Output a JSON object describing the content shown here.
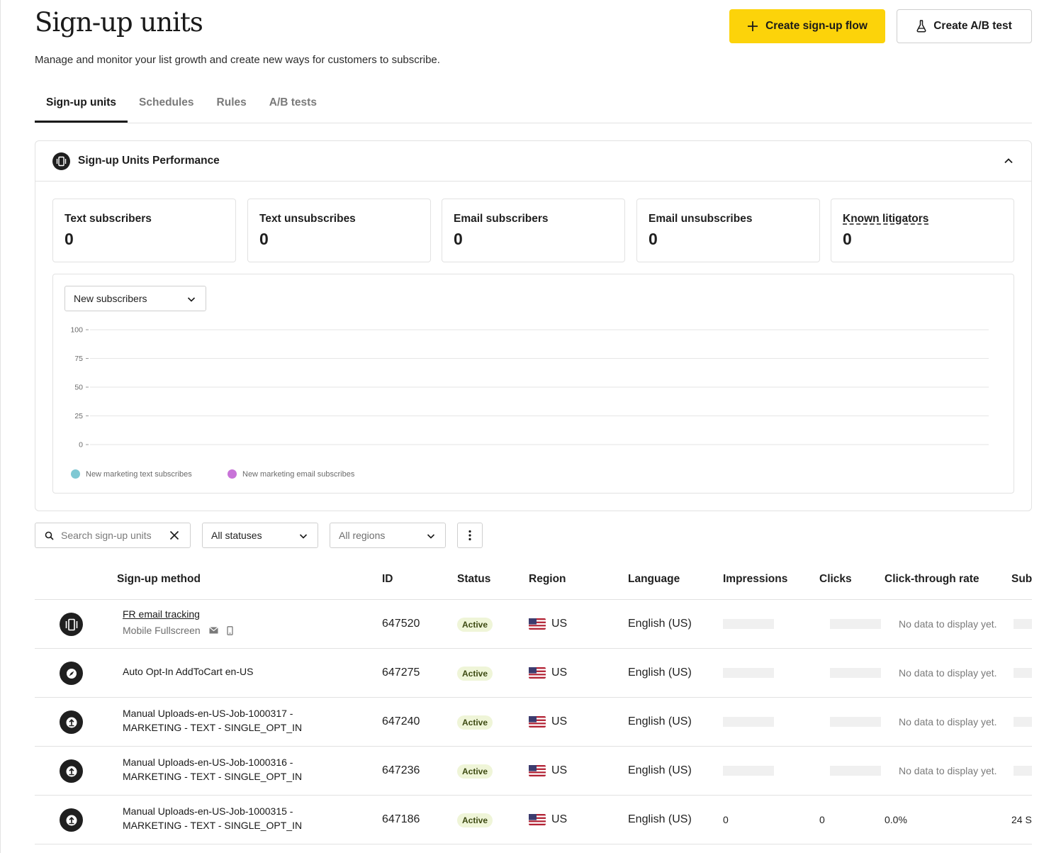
{
  "header": {
    "title": "Sign-up units",
    "subtitle": "Manage and monitor your list growth and create new ways for customers to subscribe.",
    "primary_button": "Create sign-up flow",
    "secondary_button": "Create A/B test"
  },
  "tabs": [
    {
      "label": "Sign-up units",
      "active": true
    },
    {
      "label": "Schedules",
      "active": false
    },
    {
      "label": "Rules",
      "active": false
    },
    {
      "label": "A/B tests",
      "active": false
    }
  ],
  "performance": {
    "title": "Sign-up Units Performance",
    "stats": [
      {
        "label": "Text subscribers",
        "value": "0"
      },
      {
        "label": "Text unsubscribes",
        "value": "0"
      },
      {
        "label": "Email subscribers",
        "value": "0"
      },
      {
        "label": "Email unsubscribes",
        "value": "0"
      },
      {
        "label": "Known litigators",
        "value": "0"
      }
    ],
    "metric_select": "New subscribers"
  },
  "chart_data": {
    "type": "line",
    "title": "",
    "xlabel": "",
    "ylabel": "",
    "ylim": [
      0,
      100
    ],
    "yticks": [
      100,
      75,
      50,
      25,
      0
    ],
    "grid": true,
    "legend_placement": "bottom-left",
    "series": [
      {
        "name": "New marketing text subscribes",
        "color": "#7ec8d3",
        "values": []
      },
      {
        "name": "New marketing email subscribes",
        "color": "#c873d8",
        "values": []
      }
    ]
  },
  "filters": {
    "search_placeholder": "Search sign-up units",
    "status_select": "All statuses",
    "region_select": "All regions"
  },
  "table": {
    "columns": [
      "Sign-up method",
      "ID",
      "Status",
      "Region",
      "Language",
      "Impressions",
      "Clicks",
      "Click-through rate",
      "Sub"
    ],
    "rows": [
      {
        "icon": "mobile-fullscreen-icon",
        "method": "FR email tracking",
        "is_link": true,
        "method_sub": "Mobile Fullscreen",
        "id": "647520",
        "status": "Active",
        "region": "US",
        "language": "English (US)",
        "impressions": "",
        "clicks": "",
        "ctr": "No data to display yet.",
        "sub": ""
      },
      {
        "icon": "compass-icon",
        "method": "Auto Opt-In AddToCart en-US",
        "is_link": false,
        "method_sub": "",
        "id": "647275",
        "status": "Active",
        "region": "US",
        "language": "English (US)",
        "impressions": "",
        "clicks": "",
        "ctr": "No data to display yet.",
        "sub": ""
      },
      {
        "icon": "upload-icon",
        "method_line1": "Manual Uploads-en-US-Job-1000317 -",
        "method_line2": "MARKETING - TEXT - SINGLE_OPT_IN",
        "id": "647240",
        "status": "Active",
        "region": "US",
        "language": "English (US)",
        "impressions": "",
        "clicks": "",
        "ctr": "No data to display yet.",
        "sub": ""
      },
      {
        "icon": "upload-icon",
        "method_line1": "Manual Uploads-en-US-Job-1000316 -",
        "method_line2": "MARKETING - TEXT - SINGLE_OPT_IN",
        "id": "647236",
        "status": "Active",
        "region": "US",
        "language": "English (US)",
        "impressions": "",
        "clicks": "",
        "ctr": "No data to display yet.",
        "sub": ""
      },
      {
        "icon": "upload-icon",
        "method_line1": "Manual Uploads-en-US-Job-1000315 -",
        "method_line2": "MARKETING - TEXT - SINGLE_OPT_IN",
        "id": "647186",
        "status": "Active",
        "region": "US",
        "language": "English (US)",
        "impressions": "0",
        "clicks": "0",
        "ctr": "0.0%",
        "sub": "24 S"
      }
    ]
  }
}
